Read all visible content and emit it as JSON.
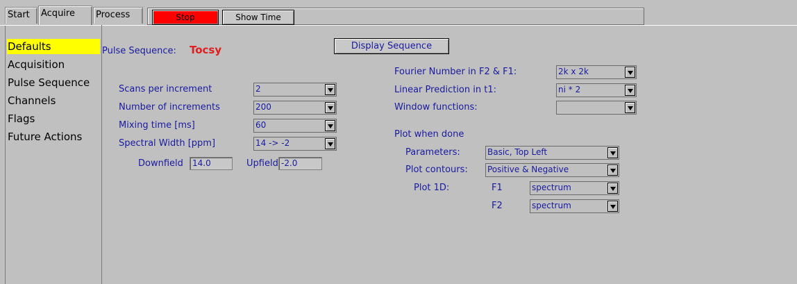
{
  "tabs": [
    "Start",
    "Acquire",
    "Process"
  ],
  "toolbar": {
    "stop_label": "Stop",
    "show_time_label": "Show Time"
  },
  "nav": [
    "Defaults",
    "Acquisition",
    "Pulse Sequence",
    "Channels",
    "Flags",
    "Future Actions"
  ],
  "pulse": {
    "label": "Pulse Sequence:",
    "value": "Tocsy",
    "display_button": "Display Sequence"
  },
  "left": {
    "scans_label": "Scans per increment",
    "scans_value": "2",
    "increments_label": "Number of increments",
    "increments_value": "200",
    "mixing_label": "Mixing time [ms]",
    "mixing_value": "60",
    "sw_label": "Spectral Width [ppm]",
    "sw_value": "14 -> -2",
    "downfield_label": "Downfield",
    "downfield_value": "14.0",
    "upfield_label": "Upfield",
    "upfield_value": "-2.0"
  },
  "right": {
    "fourier_label": "Fourier Number in F2 & F1:",
    "fourier_value": "2k x 2k",
    "lp_label": "Linear Prediction in t1:",
    "lp_value": "ni * 2",
    "window_label": "Window functions:",
    "window_value": "",
    "plot_label": "Plot when done",
    "params_label": "Parameters:",
    "params_value": "Basic, Top Left",
    "contours_label": "Plot contours:",
    "contours_value": "Positive & Negative",
    "plot1d_label": "Plot 1D:",
    "f1_label": "F1",
    "f1_value": "spectrum",
    "f2_label": "F2",
    "f2_value": "spectrum"
  },
  "colors": {
    "background": "#c0c0c0",
    "stop": "#ff0000",
    "selected": "#ffff00",
    "label": "#1a1aa0",
    "sequence": "#e02020"
  }
}
